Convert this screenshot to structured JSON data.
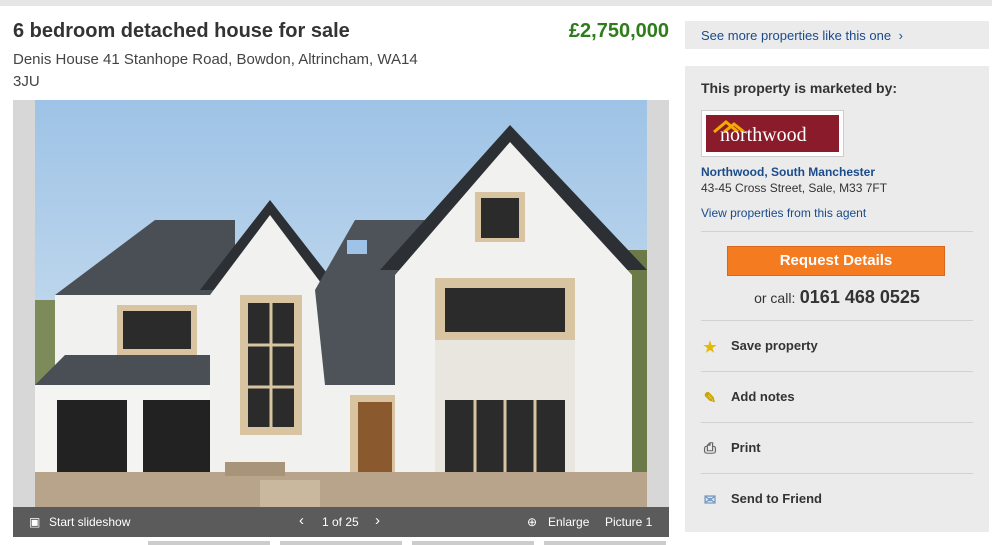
{
  "listing": {
    "title": "6 bedroom detached house for sale",
    "price": "£2,750,000",
    "address": "Denis House 41 Stanhope Road, Bowdon, Altrincham, WA14 3JU"
  },
  "gallery": {
    "start_slideshow": "Start slideshow",
    "counter": "1 of 25",
    "prev_icon": "chevron-left",
    "next_icon": "chevron-right",
    "enlarge": "Enlarge",
    "picture_label": "Picture 1"
  },
  "sidebar": {
    "see_more": "See more properties like this one",
    "marketed_by": "This property is marketed by:",
    "agent_logo_text": "northwood",
    "agent_name": "Northwood, South Manchester",
    "agent_address": "43-45 Cross Street, Sale, M33 7FT",
    "view_agent_properties": "View properties from this agent",
    "request_details": "Request Details",
    "call_prefix": "or call:",
    "phone": "0161 468 0525",
    "actions": [
      {
        "label": "Save property",
        "icon": "star-icon"
      },
      {
        "label": "Add notes",
        "icon": "note-icon"
      },
      {
        "label": "Print",
        "icon": "printer-icon"
      },
      {
        "label": "Send to Friend",
        "icon": "envelope-icon"
      }
    ]
  },
  "colors": {
    "price_green": "#2e7d1a",
    "link_blue": "#1a4b8c",
    "cta_orange": "#f47b20",
    "agent_brand": "#8a1b2a"
  }
}
